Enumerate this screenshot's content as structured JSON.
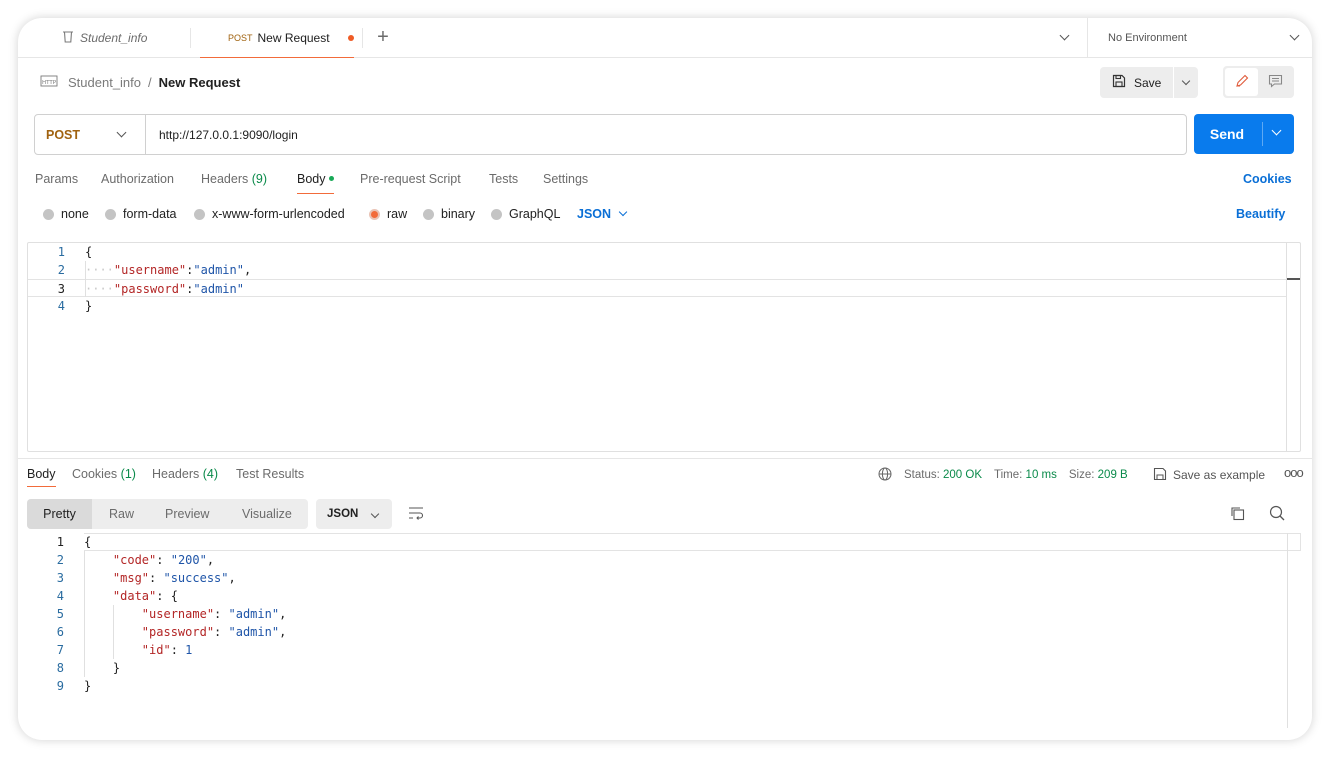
{
  "tabs": {
    "collection_tab": "Student_info",
    "request_tab_method": "POST",
    "request_tab_name": "New Request",
    "environment": "No Environment"
  },
  "breadcrumb": {
    "collection": "Student_info",
    "separator": "/",
    "request": "New Request"
  },
  "toolbar": {
    "save_label": "Save"
  },
  "request": {
    "method": "POST",
    "url": "http://127.0.0.1:9090/login",
    "send_label": "Send"
  },
  "request_tabs": {
    "params": "Params",
    "authorization": "Authorization",
    "headers": "Headers",
    "headers_count": "(9)",
    "body": "Body",
    "prerequest": "Pre-request Script",
    "tests": "Tests",
    "settings": "Settings",
    "cookies": "Cookies"
  },
  "body_types": {
    "none": "none",
    "form_data": "form-data",
    "urlencoded": "x-www-form-urlencoded",
    "raw": "raw",
    "binary": "binary",
    "graphql": "GraphQL",
    "language": "JSON",
    "beautify": "Beautify"
  },
  "request_body": {
    "line_numbers": [
      "1",
      "2",
      "3",
      "4"
    ],
    "open_brace": "{",
    "line2_key": "\"username\"",
    "line2_value": "\"admin\"",
    "line3_key": "\"password\"",
    "line3_value": "\"admin\"",
    "close_brace": "}"
  },
  "response_tabs": {
    "body": "Body",
    "cookies": "Cookies",
    "cookies_count": "(1)",
    "headers": "Headers",
    "headers_count": "(4)",
    "test_results": "Test Results"
  },
  "response_meta": {
    "status_label": "Status:",
    "status_value": "200 OK",
    "time_label": "Time:",
    "time_value": "10 ms",
    "size_label": "Size:",
    "size_value": "209 B",
    "save_example": "Save as example",
    "more": "ooo"
  },
  "response_view": {
    "pretty": "Pretty",
    "raw": "Raw",
    "preview": "Preview",
    "visualize": "Visualize",
    "format": "JSON"
  },
  "response_body": {
    "line_numbers": [
      "1",
      "2",
      "3",
      "4",
      "5",
      "6",
      "7",
      "8",
      "9"
    ],
    "l1": "{",
    "l2_key": "\"code\"",
    "l2_value": "\"200\"",
    "l3_key": "\"msg\"",
    "l3_value": "\"success\"",
    "l4_key": "\"data\"",
    "l4_brace": "{",
    "l5_key": "\"username\"",
    "l5_value": "\"admin\"",
    "l6_key": "\"password\"",
    "l6_value": "\"admin\"",
    "l7_key": "\"id\"",
    "l7_value": "1",
    "l8": "}",
    "l9": "}"
  },
  "colors": {
    "accent_blue": "#097bed",
    "method_orange": "#a0620f",
    "tab_underline": "#f26b3a",
    "status_green": "#0a8a4a"
  }
}
